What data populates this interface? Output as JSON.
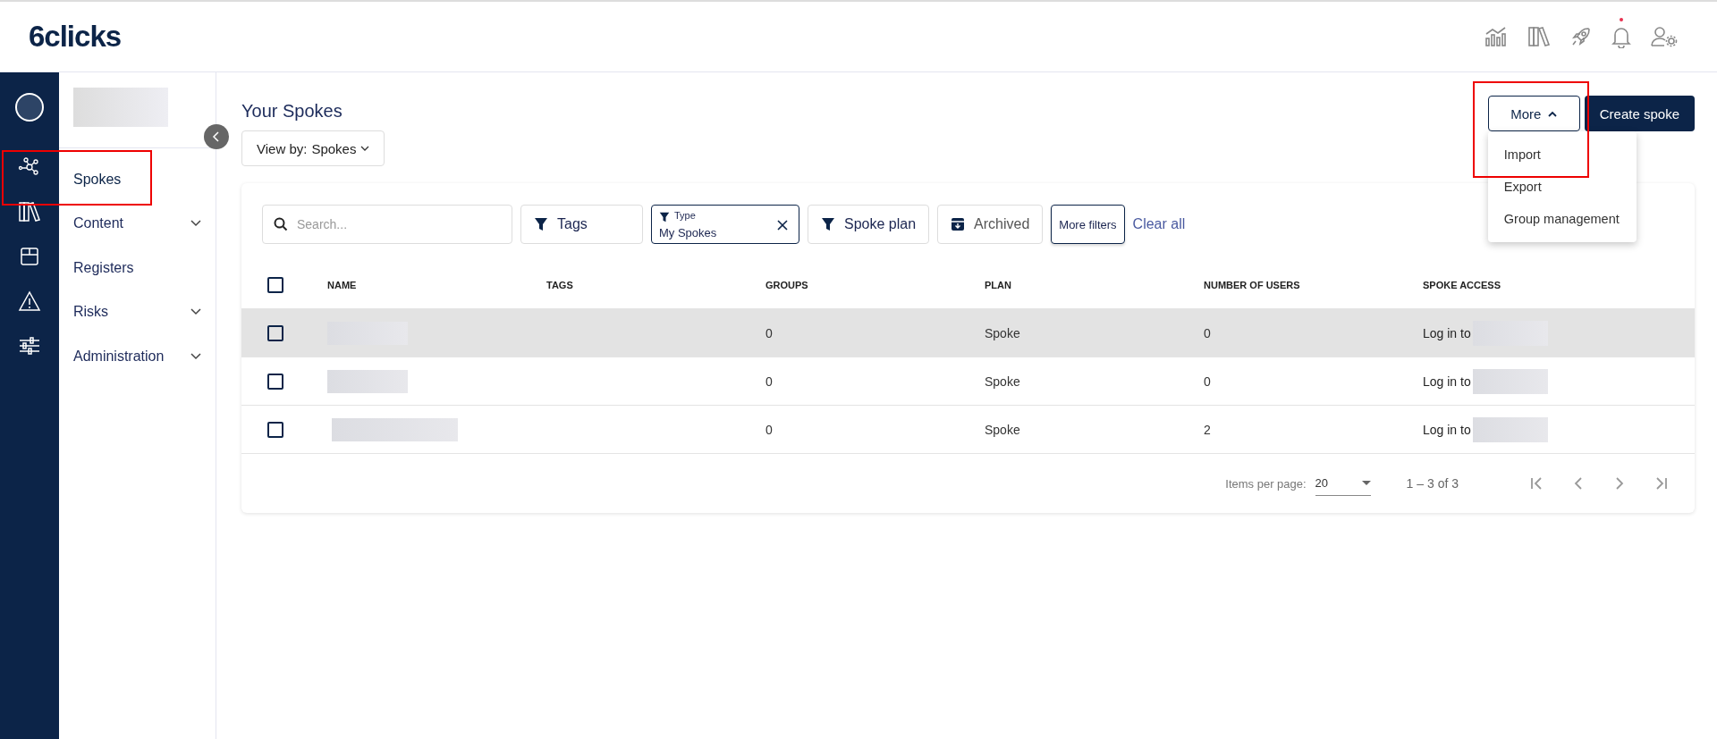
{
  "header": {
    "logo": "6clicks",
    "notification_unread": true
  },
  "sidebar": {
    "items": [
      {
        "label": "Spokes",
        "kind": "link",
        "selected": true,
        "highlighted": true
      },
      {
        "label": "Content",
        "kind": "group",
        "selected": false,
        "highlighted": false
      },
      {
        "label": "Registers",
        "kind": "link",
        "selected": false,
        "highlighted": false
      },
      {
        "label": "Risks",
        "kind": "group",
        "selected": false,
        "highlighted": false
      },
      {
        "label": "Administration",
        "kind": "group",
        "selected": false,
        "highlighted": false
      }
    ]
  },
  "page": {
    "title": "Your Spokes",
    "view_by": {
      "label": "View by:",
      "value": "Spokes"
    }
  },
  "actions": {
    "more": {
      "label": "More",
      "expanded": true,
      "highlighted": true,
      "menu": [
        "Import",
        "Export",
        "Group management"
      ]
    },
    "create": "Create spoke"
  },
  "filters": {
    "search": {
      "placeholder": "Search..."
    },
    "chips": [
      {
        "kind": "filter",
        "label": "Tags"
      },
      {
        "kind": "active",
        "label": "Type",
        "value": "My Spokes"
      },
      {
        "kind": "filter",
        "label": "Spoke plan"
      },
      {
        "kind": "archive",
        "label": "Archived"
      },
      {
        "kind": "more",
        "label": "More filters"
      }
    ],
    "clear": "Clear all"
  },
  "table": {
    "all_checked": false,
    "columns": [
      "NAME",
      "TAGS",
      "GROUPS",
      "PLAN",
      "NUMBER OF USERS",
      "SPOKE ACCESS"
    ],
    "rows": [
      {
        "checked": false,
        "hovered": true,
        "groups": "0",
        "plan": "Spoke",
        "users": "0",
        "access": "Log in to"
      },
      {
        "checked": false,
        "hovered": false,
        "groups": "0",
        "plan": "Spoke",
        "users": "0",
        "access": "Log in to"
      },
      {
        "checked": false,
        "hovered": false,
        "groups": "0",
        "plan": "Spoke",
        "users": "2",
        "access": "Log in to"
      }
    ]
  },
  "pagination": {
    "label": "Items per page:",
    "page_size": "20",
    "range": "1 – 3 of 3"
  }
}
